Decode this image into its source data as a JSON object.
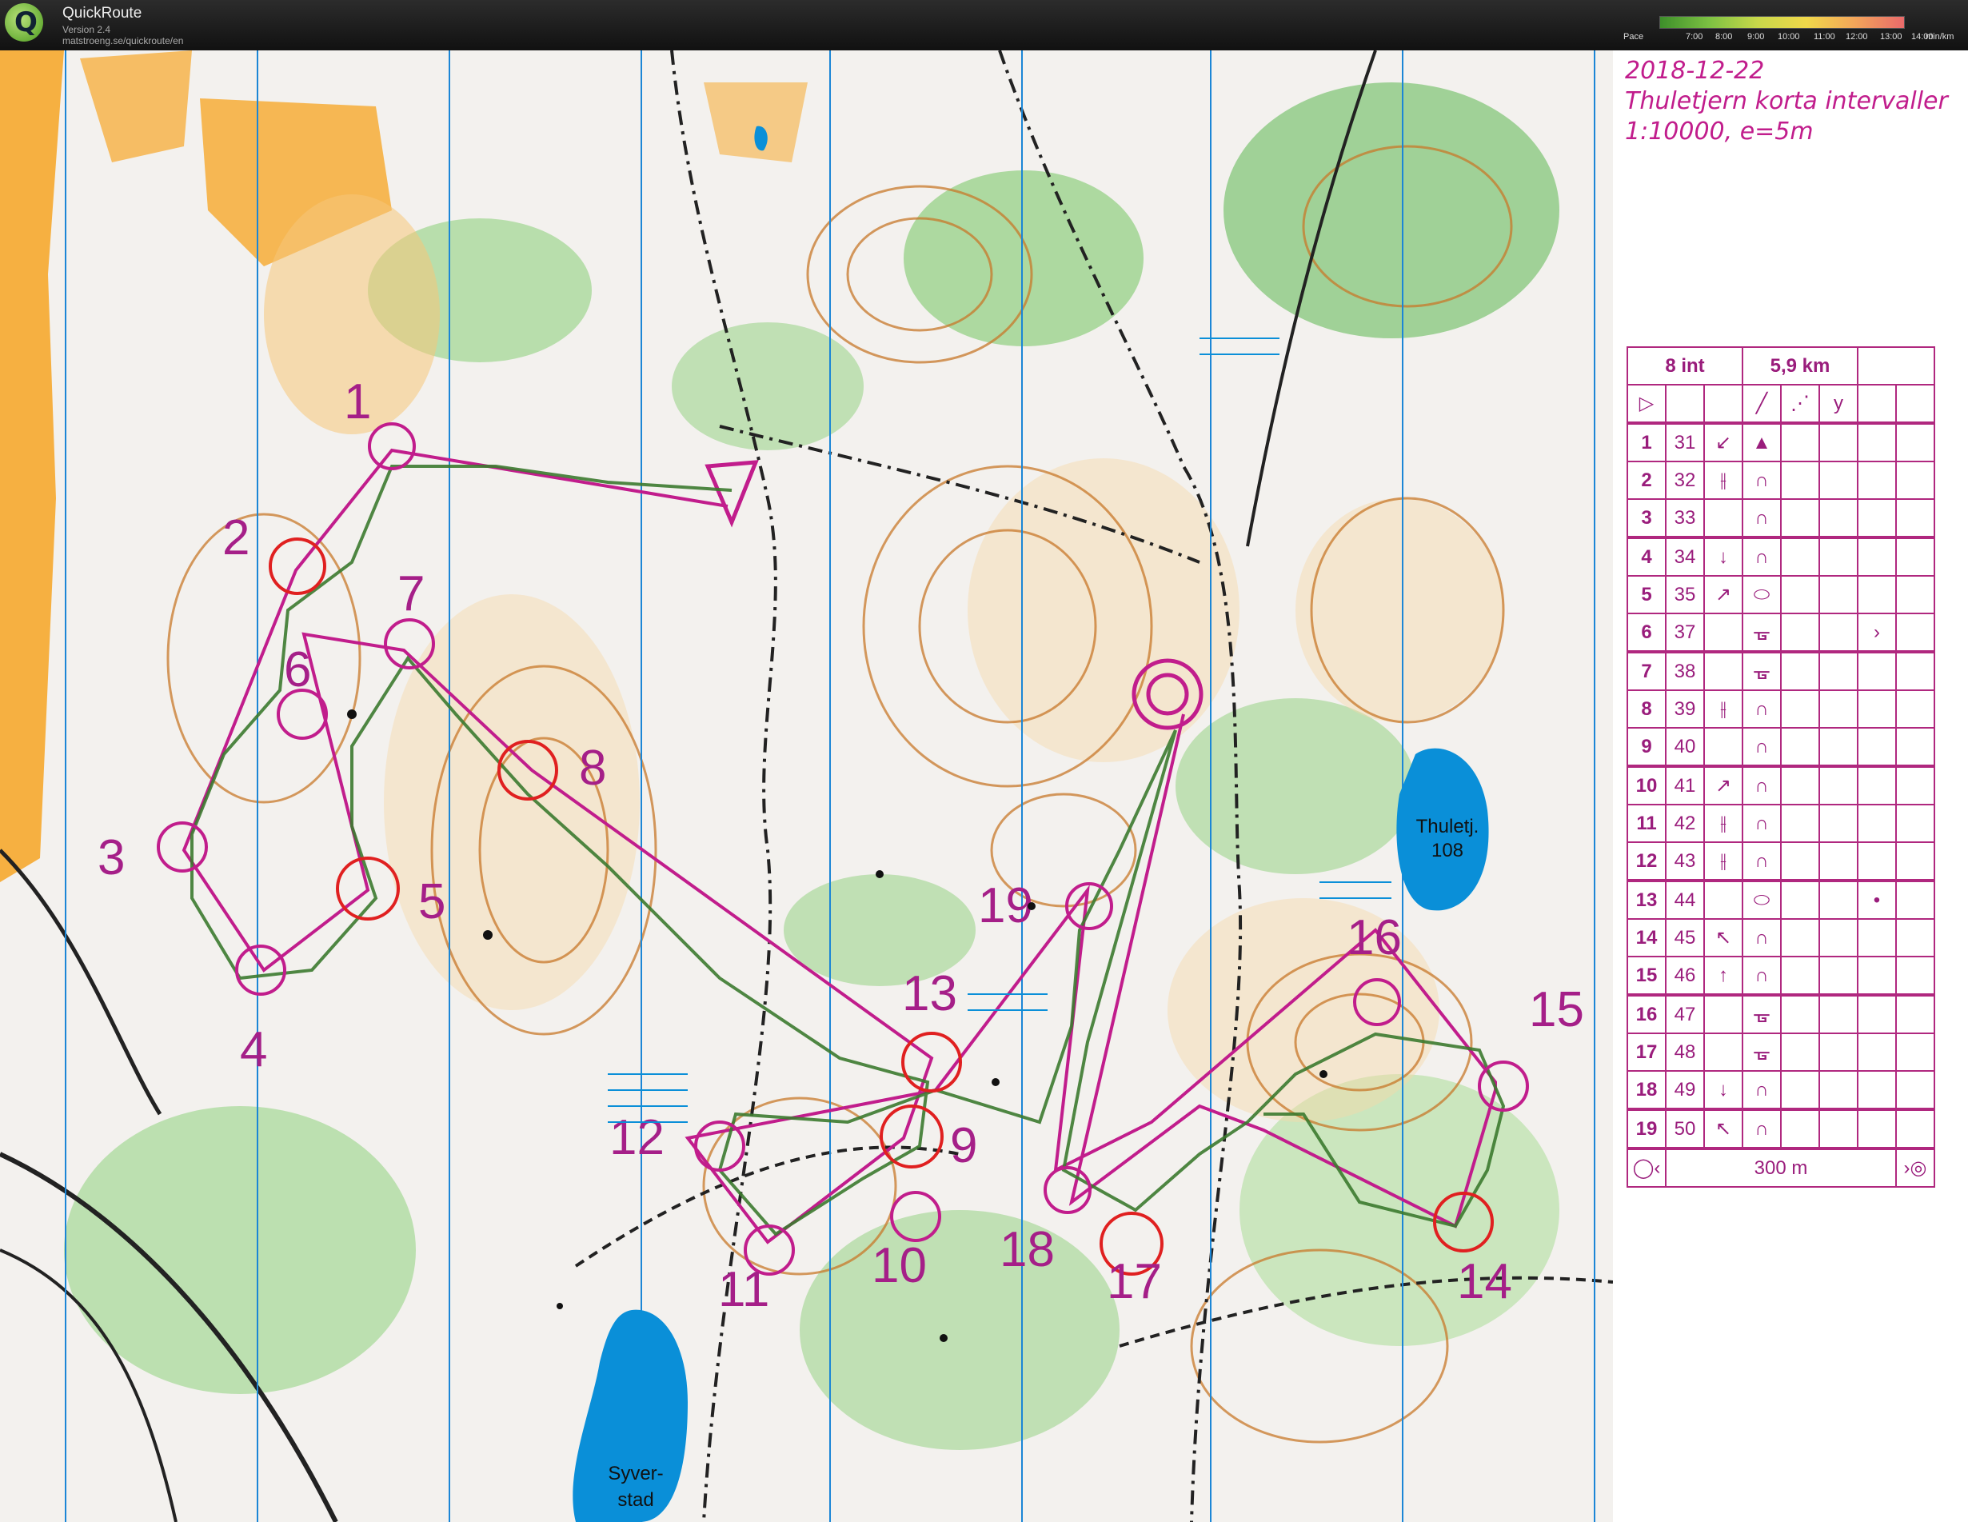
{
  "app": {
    "name": "QuickRoute",
    "version": "Version 2.4",
    "url": "matstroeng.se/quickroute/en",
    "logo_letter": "Q"
  },
  "pace_legend": {
    "label": "Pace",
    "ticks": [
      "7:00",
      "8:00",
      "9:00",
      "10:00",
      "11:00",
      "12:00",
      "13:00",
      "14:00"
    ],
    "unit": "min/km"
  },
  "map_header": {
    "date": "2018-12-22",
    "title": "Thuletjern korta intervaller",
    "scale": "1:10000, e=5m"
  },
  "map_labels": {
    "lake_east": "Thuletj.",
    "lake_east_height": "108",
    "lake_south_1": "Syver-",
    "lake_south_2": "stad",
    "scale_text": "300 m"
  },
  "controls": [
    {
      "n": "1"
    },
    {
      "n": "2"
    },
    {
      "n": "3"
    },
    {
      "n": "4"
    },
    {
      "n": "5"
    },
    {
      "n": "6"
    },
    {
      "n": "7"
    },
    {
      "n": "8"
    },
    {
      "n": "9"
    },
    {
      "n": "10"
    },
    {
      "n": "11"
    },
    {
      "n": "12"
    },
    {
      "n": "13"
    },
    {
      "n": "14"
    },
    {
      "n": "15"
    },
    {
      "n": "16"
    },
    {
      "n": "17"
    },
    {
      "n": "18"
    },
    {
      "n": "19"
    }
  ],
  "description_sheet": {
    "header_left": "8 int",
    "header_right": "5,9 km",
    "rows": [
      {
        "num": "1",
        "code": "31",
        "dir": "↙",
        "feat": "▲",
        "extra": ""
      },
      {
        "num": "2",
        "code": "32",
        "dir": "⫲",
        "feat": "∩",
        "extra": ""
      },
      {
        "num": "3",
        "code": "33",
        "dir": "",
        "feat": "∩",
        "extra": ""
      },
      {
        "num": "4",
        "code": "34",
        "dir": "↓",
        "feat": "∩",
        "extra": ""
      },
      {
        "num": "5",
        "code": "35",
        "dir": "↗",
        "feat": "⬭",
        "extra": ""
      },
      {
        "num": "6",
        "code": "37",
        "dir": "",
        "feat": "ᚗ",
        "extra": "›"
      },
      {
        "num": "7",
        "code": "38",
        "dir": "",
        "feat": "ᚗ",
        "extra": ""
      },
      {
        "num": "8",
        "code": "39",
        "dir": "⫲",
        "feat": "∩",
        "extra": ""
      },
      {
        "num": "9",
        "code": "40",
        "dir": "",
        "feat": "∩",
        "extra": ""
      },
      {
        "num": "10",
        "code": "41",
        "dir": "↗",
        "feat": "∩",
        "extra": ""
      },
      {
        "num": "11",
        "code": "42",
        "dir": "⫲",
        "feat": "∩",
        "extra": ""
      },
      {
        "num": "12",
        "code": "43",
        "dir": "⫲",
        "feat": "∩",
        "extra": ""
      },
      {
        "num": "13",
        "code": "44",
        "dir": "",
        "feat": "⬭",
        "extra": "•"
      },
      {
        "num": "14",
        "code": "45",
        "dir": "↖",
        "feat": "∩",
        "extra": ""
      },
      {
        "num": "15",
        "code": "46",
        "dir": "↑",
        "feat": "∩",
        "extra": ""
      },
      {
        "num": "16",
        "code": "47",
        "dir": "",
        "feat": "ᚗ",
        "extra": ""
      },
      {
        "num": "17",
        "code": "48",
        "dir": "",
        "feat": "ᚗ",
        "extra": ""
      },
      {
        "num": "18",
        "code": "49",
        "dir": "↓",
        "feat": "∩",
        "extra": ""
      },
      {
        "num": "19",
        "code": "50",
        "dir": "↖",
        "feat": "∩",
        "extra": ""
      }
    ],
    "footer": "300 m"
  },
  "colors": {
    "course": "#c11d8c",
    "route": "#3c7a2f",
    "red_circle": "#e02020",
    "water": "#0a8fd8",
    "open_land": "#f6b041",
    "forest_green": "#7cc372"
  }
}
